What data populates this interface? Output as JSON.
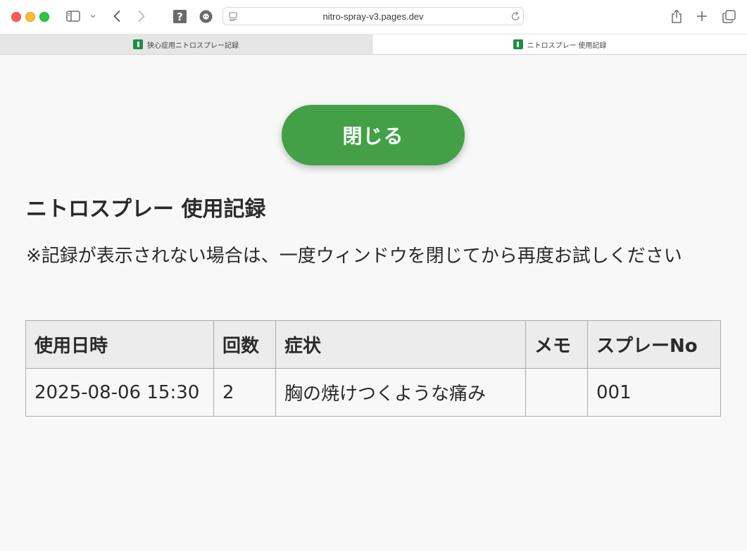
{
  "browser": {
    "url": "nitro-spray-v3.pages.dev",
    "tabs": [
      {
        "title": "狭心症用ニトロスプレー記録",
        "active": false
      },
      {
        "title": "ニトロスプレー 使用記録",
        "active": true
      }
    ],
    "icons": [
      "sidebar-icon",
      "chevron-down-icon",
      "back-icon",
      "forward-icon",
      "help-icon",
      "privacy-icon",
      "reader-icon",
      "reload-icon",
      "share-icon",
      "new-tab-icon",
      "tab-overview-icon"
    ]
  },
  "page": {
    "close_button": "閉じる",
    "title": "ニトロスプレー 使用記録",
    "note": "※記録が表示されない場合は、一度ウィンドウを閉じてから再度お試しください",
    "accent_color": "#43a047",
    "table": {
      "headers": [
        "使用日時",
        "回数",
        "症状",
        "メモ",
        "スプレーNo"
      ],
      "rows": [
        [
          "2025-08-06 15:30",
          "2",
          "胸の焼けつくような痛み",
          "",
          "001"
        ]
      ]
    }
  }
}
